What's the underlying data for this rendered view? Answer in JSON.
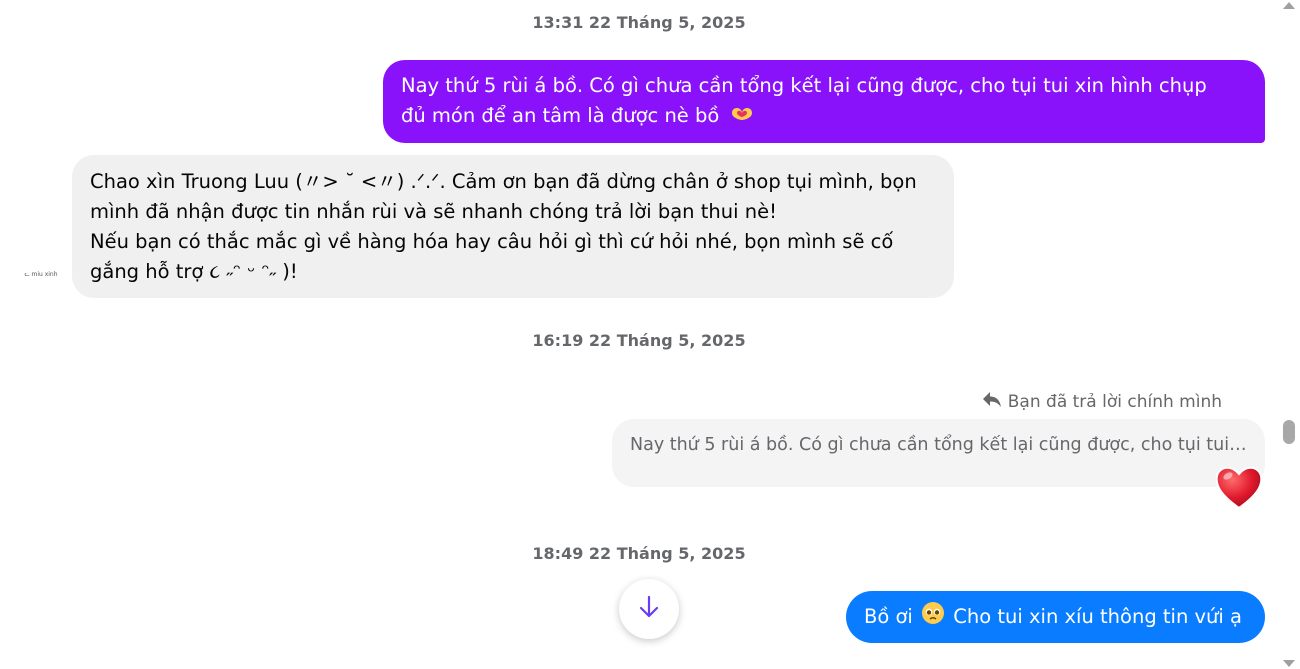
{
  "timestamps": {
    "t1": "13:31 22 Tháng 5, 2025",
    "t2": "16:19 22 Tháng 5, 2025",
    "t3": "18:49 22 Tháng 5, 2025"
  },
  "messages": {
    "m1": {
      "line1": "Nay thứ 5 rùi á bồ. Có gì chưa cần tổng kết lại cũng được, cho tụi tui xin hình chụp",
      "line2": "đủ món để an tâm là được nè bồ",
      "emoji": "heart-hands"
    },
    "m2": {
      "line1": "Chao xìn Truong Luu (〃> ˘ <〃) .ᐟ.ᐟ. Cảm ơn bạn đã dừng chân ở shop tụi mình, bọn",
      "line2": "mình đã nhận được tin nhắn rùi và sẽ nhanh chóng trả lời bạn thui nè!",
      "line3": "Nếu bạn có thắc mắc gì về hàng hóa hay câu hỏi gì thì cứ hỏi nhé, bọn mình sẽ cố",
      "line4": "gắng hỗ trợ ૮ ˶ᵔ ᵕ ᵔ˶ )!"
    },
    "reply": {
      "label": "Bạn đã trả lời chính mình",
      "quoted": "Nay thứ 5 rùi á bồ. Có gì chưa cần tổng kết lại cũng được, cho tụi tui x...",
      "reaction": "heart"
    },
    "m3": {
      "before": "Bồ ơi",
      "after": "Cho tui xin xíu thông tin vứi ạ",
      "emoji": "pleading-face"
    }
  },
  "avatar_text": "ᓚ miu xinh",
  "colors": {
    "outgoing_purple": "#8a12fb",
    "outgoing_blue": "#0a7cff",
    "incoming_gray": "#f0f0f0",
    "timestamp_gray": "#65676b"
  },
  "icons": [
    "reply-arrow-icon",
    "heart-reaction-icon",
    "arrow-down-icon",
    "heart-hands-emoji-icon",
    "pleading-face-emoji-icon"
  ]
}
